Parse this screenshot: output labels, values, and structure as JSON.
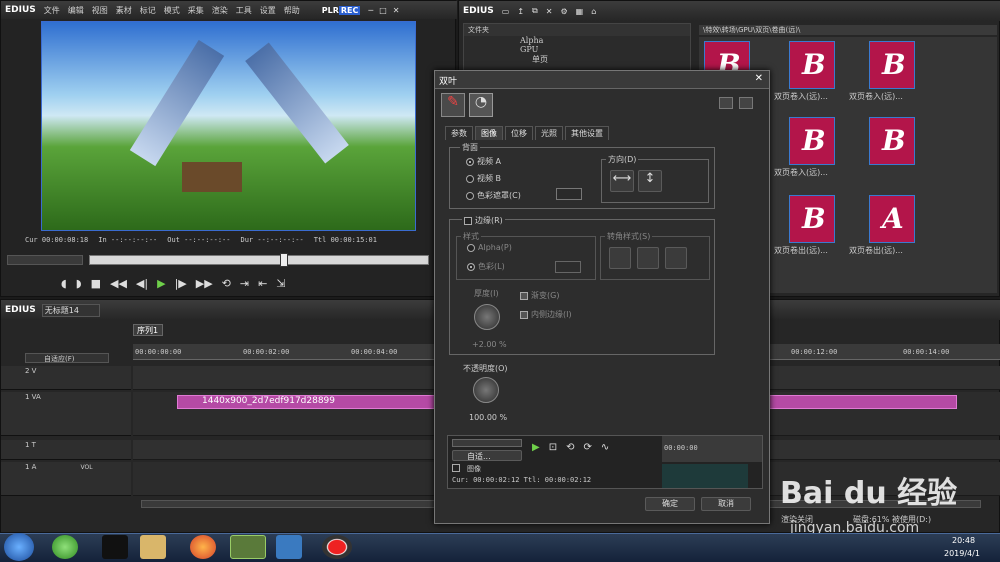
{
  "player": {
    "brand": "EDIUS",
    "menus": [
      "文件",
      "编辑",
      "视图",
      "素材",
      "标记",
      "模式",
      "采集",
      "渲染",
      "工具",
      "设置",
      "帮助"
    ],
    "mode_plr": "PLR",
    "mode_rec": "REC",
    "cur_label": "Cur",
    "cur": "00:00:08:18",
    "in_label": "In",
    "in": "--:--:--:--",
    "out_label": "Out",
    "out": "--:--:--:--",
    "dur_label": "Dur",
    "dur": "--:--:--:--",
    "ttl_label": "Ttl",
    "ttl": "00:00:15:01"
  },
  "bin": {
    "brand": "EDIUS",
    "folder_header": "文件夹",
    "tree": [
      "Alpha",
      "GPU",
      "单页"
    ],
    "path": "\\特效\\转场\\GPU\\双页\\卷曲(远)\\",
    "thumb_labels": [
      "双页卷入(远)...",
      "双页卷入(远)...",
      "双页卷入(远)...",
      "双页卷出(远)...",
      "双页卷出(远)..."
    ]
  },
  "timeline": {
    "brand": "EDIUS",
    "project": "无标题14",
    "sequence_tab": "序列1",
    "mode": "自适应(F)",
    "ruler": [
      "00:00:00:00",
      "00:00:02:00",
      "00:00:04:00",
      "00:00:12:00",
      "00:00:14:00"
    ],
    "tracks": [
      "2 V",
      "1 VA",
      "1 T",
      "1 A"
    ],
    "vol": "VOL",
    "clip_name": "1440x900_2d7edf917d28899"
  },
  "dialog": {
    "title": "双叶",
    "tabs": [
      "参数",
      "图像",
      "位移",
      "光照",
      "其他设置"
    ],
    "back_group": "背面",
    "opt_video_a": "视频 A",
    "opt_video_b": "视频 B",
    "opt_color": "色彩遮罩(C)",
    "direction_group": "方向(D)",
    "border_check": "边缘(R)",
    "style_group": "样式",
    "opt_alpha": "Alpha(P)",
    "opt_colorfx": "色彩(L)",
    "corner_group": "转角样式(S)",
    "thickness_label": "厚度(I)",
    "thickness_val": "+2.00 %",
    "gradient_check": "渐变(G)",
    "inner_check": "内侧边缘(I)",
    "opacity_label": "不透明度(O)",
    "opacity_val": "100.00 %",
    "auto_btn": "自适...",
    "kf_ruler": "00:00:00",
    "kf_row": "图像",
    "cur_label": "Cur",
    "cur": "00:00:02:12",
    "ttl_label": "Ttl",
    "ttl": "00:00:02:12",
    "ok": "确定",
    "cancel": "取消"
  },
  "status": {
    "left": "渲染关闭",
    "disk": "磁盘:61% 被使用(D:)"
  },
  "watermark": {
    "logo": "Bai du 经验",
    "url": "jingyan.baidu.com"
  },
  "taskbar": {
    "time": "20:48",
    "date": "2019/4/1"
  }
}
